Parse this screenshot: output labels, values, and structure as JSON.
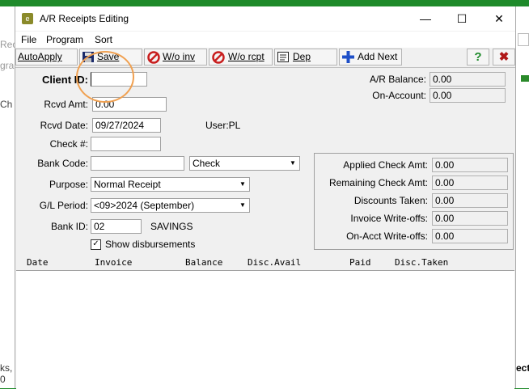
{
  "window": {
    "title": "A/R Receipts Editing",
    "icon_text": "e",
    "minimize": "—",
    "maximize": "☐",
    "close": "✕"
  },
  "background": {
    "left_texts": [
      "Rec",
      "gra",
      "Ch",
      "ks, 0"
    ],
    "right_text": "ect"
  },
  "menu": [
    "File",
    "Program",
    "Sort"
  ],
  "toolbar": {
    "autoapply": "AutoApply",
    "save": "Save",
    "wo_inv": "W/o inv",
    "wo_rcpt": "W/o rcpt",
    "dep": "Dep",
    "add_next": "Add Next",
    "help": "?",
    "exit": "✖"
  },
  "form": {
    "client_id_label": "Client ID:",
    "client_id_value": "",
    "rcvd_amt_label": "Rcvd Amt:",
    "rcvd_amt_value": "0.00",
    "rcvd_date_label": "Rcvd Date:",
    "rcvd_date_value": "09/27/2024",
    "user_label": "User:PL",
    "check_no_label": "Check #:",
    "check_no_value": "",
    "bank_code_label": "Bank Code:",
    "bank_code_value": "",
    "bank_code_type": "Check",
    "purpose_label": "Purpose:",
    "purpose_value": "Normal Receipt",
    "gl_period_label": "G/L Period:",
    "gl_period_value": "<09>2024 (September)",
    "bank_id_label": "Bank ID:",
    "bank_id_value": "02",
    "bank_id_name": "SAVINGS",
    "show_disbursements_label": "Show disbursements",
    "show_disbursements_checked": "✓"
  },
  "balances": {
    "ar_balance_label": "A/R Balance:",
    "ar_balance_value": "0.00",
    "on_account_label": "On-Account:",
    "on_account_value": "0.00"
  },
  "summary": {
    "applied_check_amt_label": "Applied Check Amt:",
    "applied_check_amt_value": "0.00",
    "remaining_check_amt_label": "Remaining Check Amt:",
    "remaining_check_amt_value": "0.00",
    "discounts_taken_label": "Discounts Taken:",
    "discounts_taken_value": "0.00",
    "invoice_writeoffs_label": "Invoice Write-offs:",
    "invoice_writeoffs_value": "0.00",
    "onacct_writeoffs_label": "On-Acct Write-offs:",
    "onacct_writeoffs_value": "0.00"
  },
  "grid": {
    "columns": [
      "Date",
      "Invoice",
      "Balance",
      "Disc.Avail",
      "Paid",
      "Disc.Taken"
    ]
  },
  "colors": {
    "accent_green": "#1e8a2a",
    "highlight_orange": "#f0a050",
    "nosign_red": "#c81e1e",
    "add_blue": "#1e4fc8"
  }
}
